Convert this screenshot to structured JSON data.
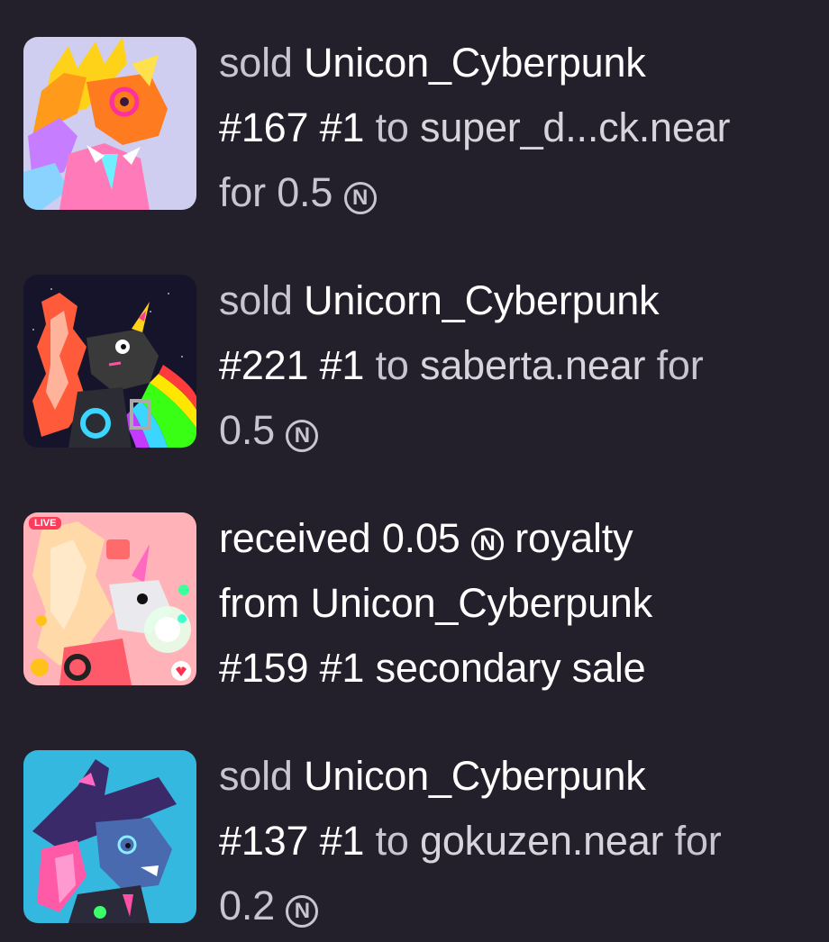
{
  "activity": [
    {
      "verb": "sold",
      "token": "Unicon_Cyberpunk",
      "token_line2": "#167 #1",
      "to_word": "to",
      "recipient": "super_d...ck.near",
      "for_word": "for",
      "amount": "0.5",
      "currency_icon": "near-icon"
    },
    {
      "verb": "sold",
      "token": "Unicorn_Cyberpunk",
      "token_line2": "#221 #1",
      "to_word": "to",
      "recipient": "saberta.near",
      "for_word": "for",
      "amount": "0.5",
      "currency_icon": "near-icon"
    },
    {
      "verb": "received",
      "amount": "0.05",
      "currency_icon": "near-icon",
      "kind": "royalty",
      "from_word": "from",
      "token": "Unicon_Cyberpunk",
      "token_line2": "#159 #1",
      "suffix": "secondary sale",
      "badge": "LIVE"
    },
    {
      "verb": "sold",
      "token": "Unicon_Cyberpunk",
      "token_line2": "#137 #1",
      "to_word": "to",
      "recipient": "gokuzen.near",
      "for_word": "for",
      "amount": "0.2",
      "currency_icon": "near-icon"
    }
  ],
  "colors": {
    "background": "#23202b",
    "text_dim": "#c8c4d0",
    "text_bright": "#ffffff"
  },
  "near_symbol": "N"
}
